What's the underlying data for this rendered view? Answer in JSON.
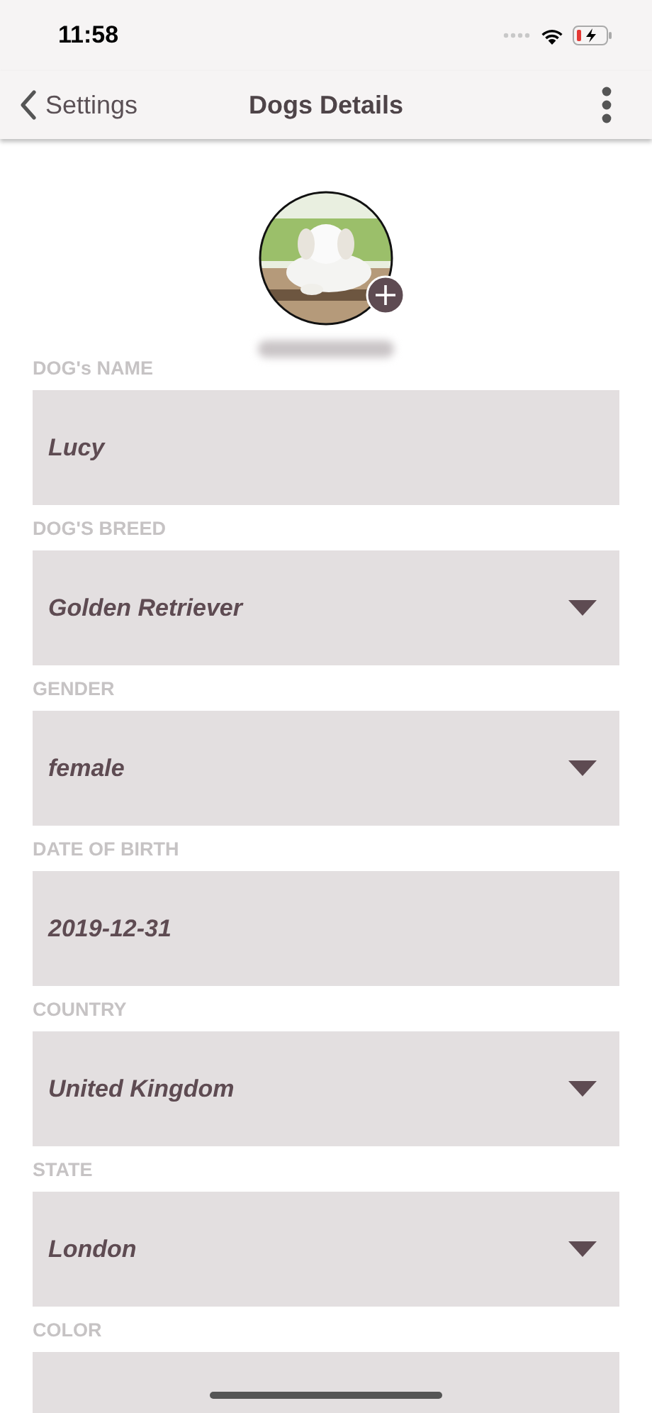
{
  "status_bar": {
    "time": "11:58"
  },
  "nav": {
    "back": "Settings",
    "title": "Dogs Details"
  },
  "fields": [
    {
      "label": "DOG's NAME",
      "kind": "text",
      "value": "Lucy"
    },
    {
      "label": "DOG'S BREED",
      "kind": "dropdown",
      "value": "Golden Retriever"
    },
    {
      "label": "GENDER",
      "kind": "dropdown",
      "value": "female"
    },
    {
      "label": "DATE OF BIRTH",
      "kind": "text",
      "value": "2019-12-31"
    },
    {
      "label": "COUNTRY",
      "kind": "dropdown",
      "value": "United Kingdom"
    },
    {
      "label": "STATE",
      "kind": "dropdown",
      "value": "London"
    },
    {
      "label": "COLOR",
      "kind": "text"
    }
  ]
}
